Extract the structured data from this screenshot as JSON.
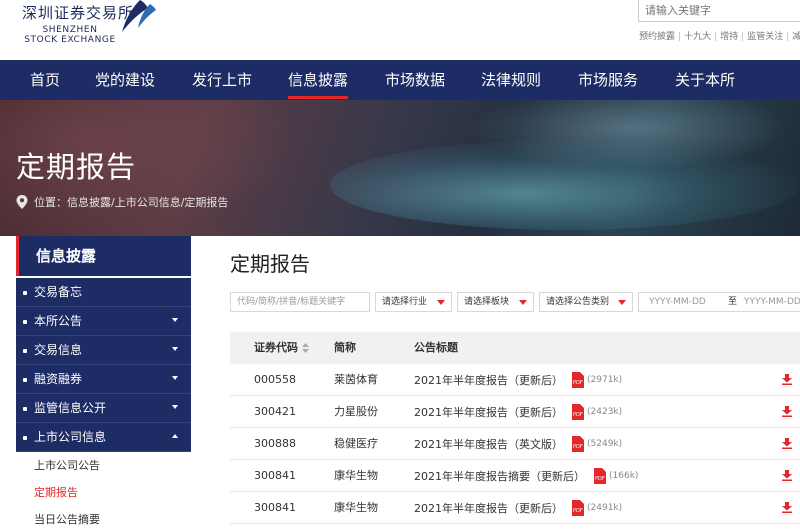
{
  "header": {
    "logo_cn": "深圳证券交易所",
    "logo_en_line1": "SHENZHEN",
    "logo_en_line2": "STOCK EXCHANGE",
    "search_placeholder": "请输入关键字",
    "hot_words": [
      "预约披露",
      "十九大",
      "增持",
      "监管关注",
      "减"
    ]
  },
  "nav": {
    "items": [
      "首页",
      "党的建设",
      "发行上市",
      "信息披露",
      "市场数据",
      "法律规则",
      "市场服务",
      "关于本所"
    ],
    "active_index": 3
  },
  "banner": {
    "title": "定期报告",
    "breadcrumb": "位置：信息披露/上市公司信息/定期报告"
  },
  "sidebar": {
    "heading": "信息披露",
    "items": [
      {
        "label": "交易备忘",
        "has_caret": false
      },
      {
        "label": "本所公告",
        "has_caret": true
      },
      {
        "label": "交易信息",
        "has_caret": true
      },
      {
        "label": "融资融券",
        "has_caret": true
      },
      {
        "label": "监管信息公开",
        "has_caret": true
      },
      {
        "label": "上市公司信息",
        "has_caret": true,
        "expanded": true
      }
    ],
    "subitems": [
      "上市公司公告",
      "定期报告",
      "当日公告摘要"
    ],
    "active_subitem": "定期报告"
  },
  "content": {
    "title": "定期报告",
    "filters": {
      "keyword_placeholder": "代码/简称/拼音/标题关键字",
      "industry": "请选择行业",
      "board": "请选择板块",
      "category": "请选择公告类别",
      "date_from": "YYYY-MM-DD",
      "date_to_label": "至",
      "date_to": "YYYY-MM-DD"
    },
    "table": {
      "headers": {
        "code": "证券代码",
        "name": "简称",
        "title": "公告标题"
      },
      "rows": [
        {
          "code": "000558",
          "name": "莱茵体育",
          "title": "2021年半年度报告（更新后）",
          "size": "(2971k)"
        },
        {
          "code": "300421",
          "name": "力星股份",
          "title": "2021年半年度报告（更新后）",
          "size": "(2423k)"
        },
        {
          "code": "300888",
          "name": "稳健医疗",
          "title": "2021年半年度报告（英文版）",
          "size": "(5249k)"
        },
        {
          "code": "300841",
          "name": "康华生物",
          "title": "2021年半年度报告摘要（更新后）",
          "size": "(166k)"
        },
        {
          "code": "300841",
          "name": "康华生物",
          "title": "2021年半年度报告（更新后）",
          "size": "(2491k)"
        }
      ]
    }
  },
  "colors": {
    "nav_bg": "#1d2c64",
    "accent_red": "#e4272a",
    "header_bg": "#f1f1f1"
  },
  "icons": {
    "pdf": "pdf-icon",
    "download": "download-icon",
    "location": "location-pin-icon",
    "sort": "sort-icon"
  }
}
